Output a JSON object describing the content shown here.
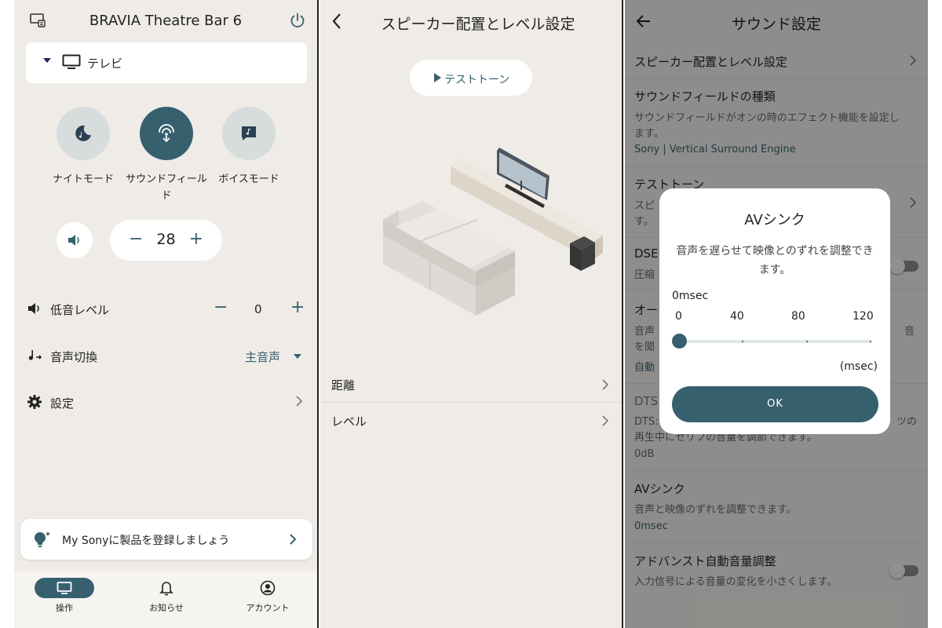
{
  "colors": {
    "accent": "#37606f",
    "background": "#efece8",
    "card": "#ffffff"
  },
  "panel1": {
    "header": {
      "title": "BRAVIA Theatre Bar 6",
      "left_icon": "device-screen-icon",
      "right_icon": "power-icon"
    },
    "input": {
      "label": "テレビ",
      "icon": "tv-icon"
    },
    "modes": [
      {
        "label": "ナイトモード",
        "icon": "moon-icon",
        "active": false
      },
      {
        "label": "サウンドフィールド",
        "icon": "sound-field-icon",
        "active": true
      },
      {
        "label": "ボイスモード",
        "icon": "voice-icon",
        "active": false
      }
    ],
    "volume": {
      "value": "28",
      "minus": "−",
      "plus": "+"
    },
    "bass": {
      "label": "低音レベル",
      "value": "0",
      "minus": "−",
      "plus": "+"
    },
    "audio_switch": {
      "label": "音声切換",
      "value": "主音声"
    },
    "settings": {
      "label": "設定"
    },
    "register": {
      "text": "My Sonyに製品を登録しましょう"
    },
    "nav": [
      {
        "label": "操作",
        "icon": "tv-icon",
        "active": true
      },
      {
        "label": "お知らせ",
        "icon": "bell-icon",
        "active": false
      },
      {
        "label": "アカウント",
        "icon": "account-icon",
        "active": false
      }
    ]
  },
  "panel2": {
    "header": {
      "title": "スピーカー配置とレベル設定"
    },
    "test_tone": "テストトーン",
    "rows": [
      {
        "label": "距離"
      },
      {
        "label": "レベル"
      }
    ]
  },
  "panel3": {
    "header": {
      "title": "サウンド設定"
    },
    "items": {
      "speaker_placement": "スピーカー配置とレベル設定",
      "sound_field_title": "サウンドフィールドの種類",
      "sound_field_desc": "サウンドフィールドがオンの時のエフェクト機能を設定します。",
      "sound_field_value": "Sony | Vertical Surround Engine",
      "test_tone_title": "テストトーン",
      "test_tone_desc_1": "スピ",
      "test_tone_desc_2": "す。",
      "dsee_title": "DSEE",
      "dsee_desc": "圧縮",
      "auto_title": "オー",
      "auto_desc_1": "音声",
      "auto_desc_1_right": "音",
      "auto_desc_2": "を聞",
      "auto_value": "自動",
      "dts_title": "DTS",
      "dts_desc_1_left": "DTS:",
      "dts_desc_1_right": "ツの",
      "dts_desc_2": "再生中にセリフの音量を調節できます。",
      "dts_value": "0dB",
      "avsync_title": "AVシンク",
      "avsync_desc": "音声と映像のずれを調整できます。",
      "avsync_value": "0msec",
      "advanced_title": "アドバンスト自動音量調整",
      "advanced_desc": "入力信号による音量の変化を小さくします。"
    },
    "dialog": {
      "title": "AVシンク",
      "message": "音声を遅らせて映像とのずれを調整できます。",
      "current": "0msec",
      "ticks": [
        "0",
        "40",
        "80",
        "120"
      ],
      "slider_fraction": 0,
      "unit": "(msec)",
      "ok": "OK"
    }
  }
}
